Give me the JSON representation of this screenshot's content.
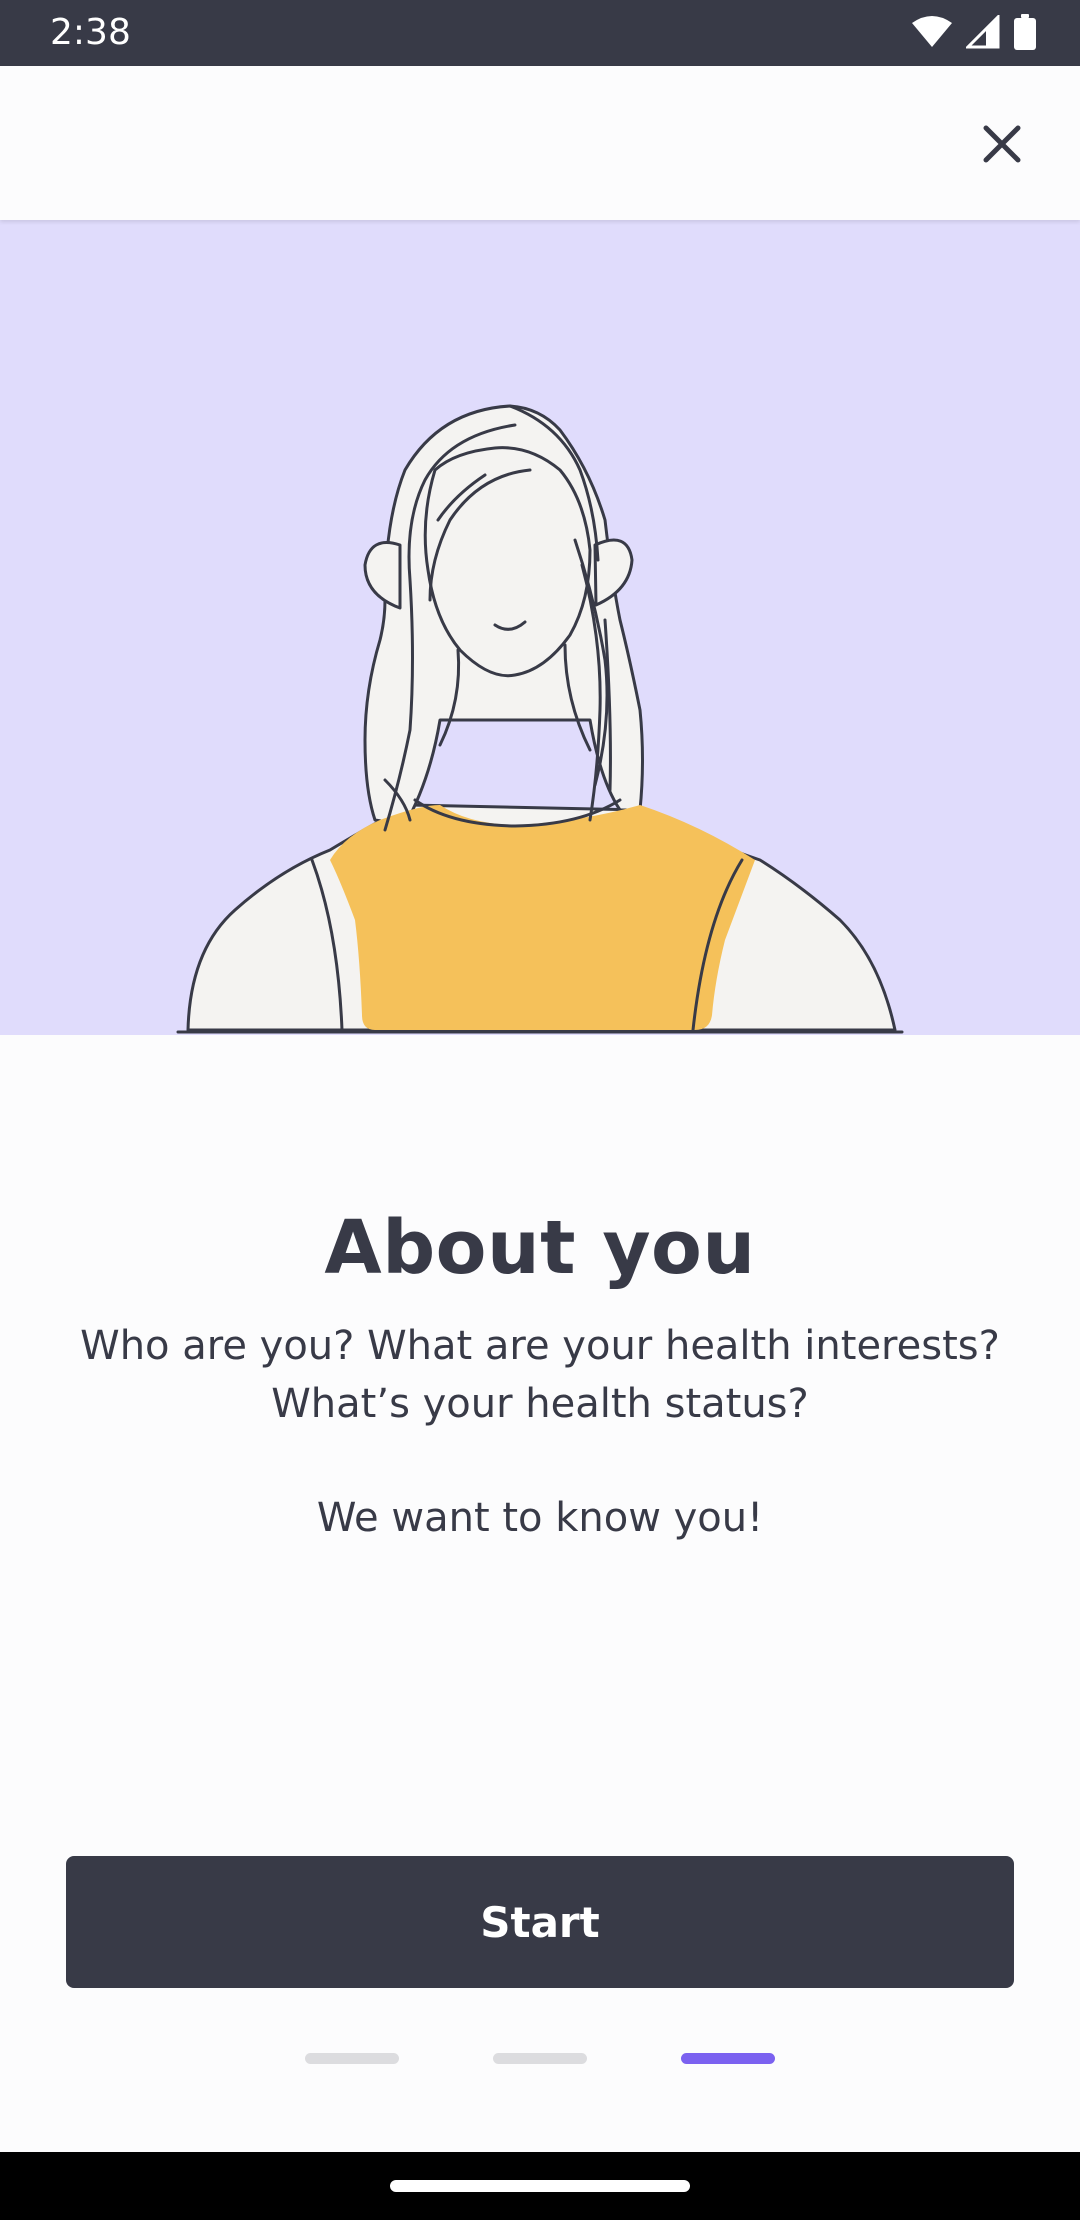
{
  "status_bar": {
    "time": "2:38",
    "icons": [
      "wifi-icon",
      "cellular-signal-icon",
      "battery-icon"
    ]
  },
  "app_bar": {
    "close_icon": "close-icon"
  },
  "hero": {
    "illustration": "woman-portrait-illustration",
    "background_color": "#e0dcfc",
    "shirt_color": "#f5c15a"
  },
  "content": {
    "title": "About you",
    "line1": "Who are you? What are your health interests?",
    "line2": "What’s your health status?",
    "line3": "We want to know you!"
  },
  "start_button": {
    "label": "Start"
  },
  "pager": {
    "total": 3,
    "active_index": 2
  },
  "colors": {
    "primary_dark": "#383a47",
    "accent": "#7b61f0",
    "inactive_dot": "#dcdcdf"
  }
}
